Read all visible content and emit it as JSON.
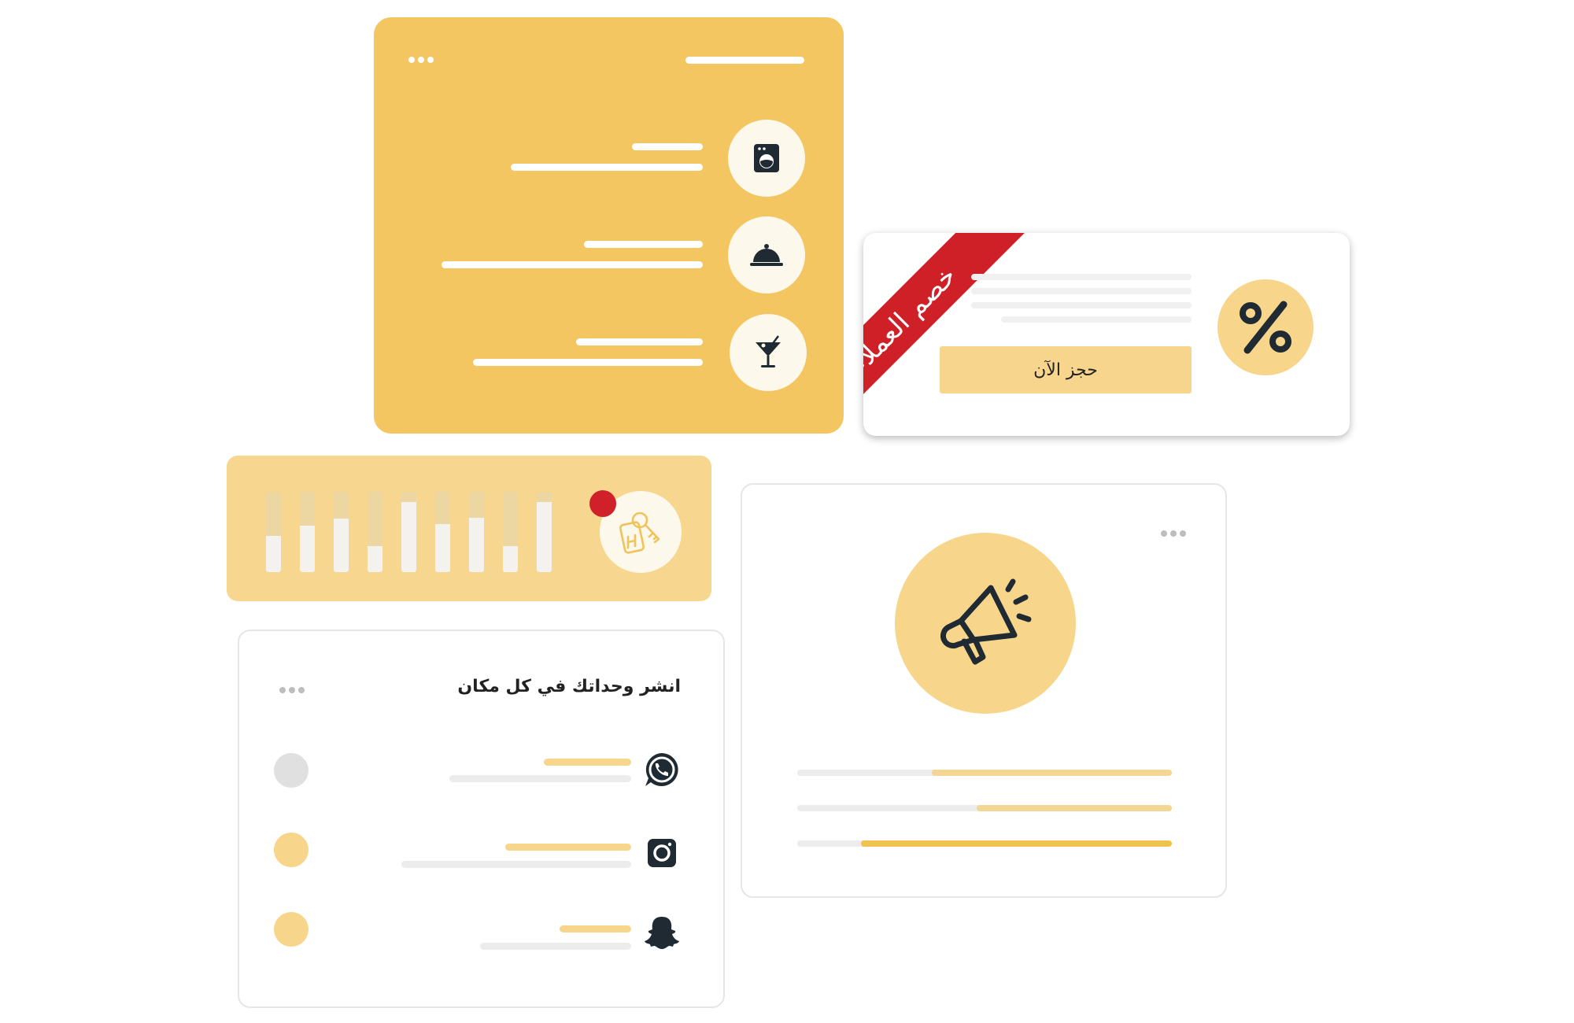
{
  "discount": {
    "ribbon_text": "خصم العملاء",
    "book_label": "حجز الآن",
    "percent_icon": "percent-icon"
  },
  "analytics": {
    "bar_levels": [
      0.45,
      0.58,
      0.67,
      0.32,
      0.87,
      0.6,
      0.68,
      0.32,
      0.87
    ],
    "notification_color": "#d0202a",
    "key_icon": "hotel-key-icon"
  },
  "campaign": {
    "megaphone_icon": "megaphone-icon",
    "progress": [
      0.64,
      0.52,
      0.83
    ]
  },
  "social": {
    "title": "انشر وحداتك في كل مكان",
    "channels": [
      {
        "icon": "whatsapp-icon",
        "status_color": "#e0e0e0"
      },
      {
        "icon": "instagram-icon",
        "status_color": "#f7d68c"
      },
      {
        "icon": "snapchat-icon",
        "status_color": "#f7d68c"
      }
    ]
  },
  "services": {
    "items": [
      {
        "icon": "washing-machine-icon"
      },
      {
        "icon": "room-service-icon"
      },
      {
        "icon": "cocktail-icon"
      }
    ]
  },
  "colors": {
    "brand_yellow": "#f3c662",
    "light_yellow": "#f7d78f",
    "ribbon_red": "#cf2028",
    "dark": "#1f2a33"
  }
}
